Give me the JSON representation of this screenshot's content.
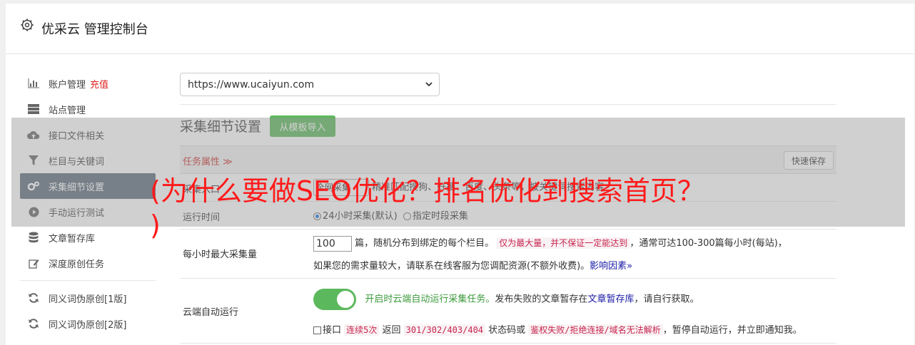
{
  "header": {
    "title": "优采云 管理控制台",
    "icon": "gear-icon"
  },
  "sidebar": {
    "items": [
      {
        "label": "账户管理",
        "extra": "充值",
        "icon": "bar-chart-icon"
      },
      {
        "label": "站点管理",
        "icon": "server-icon"
      },
      {
        "label": "接口文件相关",
        "icon": "cloud-upload-icon"
      },
      {
        "label": "栏目与关键词",
        "icon": "filter-icon"
      },
      {
        "label": "采集细节设置",
        "icon": "gears-icon",
        "active": true
      },
      {
        "label": "手动运行测试",
        "icon": "play-circle-icon"
      },
      {
        "label": "文章暂存库",
        "icon": "database-icon"
      },
      {
        "label": "深度原创任务",
        "icon": "edit-icon"
      },
      {
        "label": "同义词伪原创[1版]",
        "icon": "refresh-icon"
      },
      {
        "label": "同义词伪原创[2版]",
        "icon": "refresh-icon"
      }
    ]
  },
  "main": {
    "site_select": "https://www.ucaiyun.com",
    "section_title": "采集细节设置",
    "import_button": "从模板导入",
    "table": {
      "task_attr": "任务属性 ≫",
      "quick_save": "快速保存",
      "rows": {
        "entry": {
          "label": "采集入口",
          "select_value": "全网采集",
          "desc": "精准匹配搜狗、好搜、百度、头条等，按关键词搜索内容"
        },
        "runtime": {
          "label": "运行时间",
          "opt1": "24小时采集(默认)",
          "opt2": "指定时段采集"
        },
        "max": {
          "label": "每小时最大采集量",
          "value": "100",
          "text1": "篇，随机分布到绑定的每个栏目。",
          "warn": "仅为最大量，并不保证一定能达到",
          "text2": "，通常可达100-300篇每小时(每站)，",
          "text3": "如果您的需求量较大，请联系在线客服为您调配资源(不额外收费)。",
          "link": "影响因素»"
        },
        "cloud": {
          "label": "云端自动运行",
          "green_text": "开启时云端自动运行采集任务。",
          "text1": "发布失败的文章暂存在",
          "link": "文章暂存库",
          "text2": "，请自行获取。",
          "cb_label": "接口",
          "code1": "连续5次",
          "text3": " 返回 ",
          "code2": "301/302/403/404",
          "text4": " 状态码或 ",
          "code3": "鉴权失败/拒绝连接/域名无法解析",
          "text5": "，暂停自动运行，并立即通知我。"
        }
      }
    }
  },
  "overlay": {
    "line1": "(为什么要做SEO优化？排名优化到搜索首页？",
    "line2": ")"
  }
}
